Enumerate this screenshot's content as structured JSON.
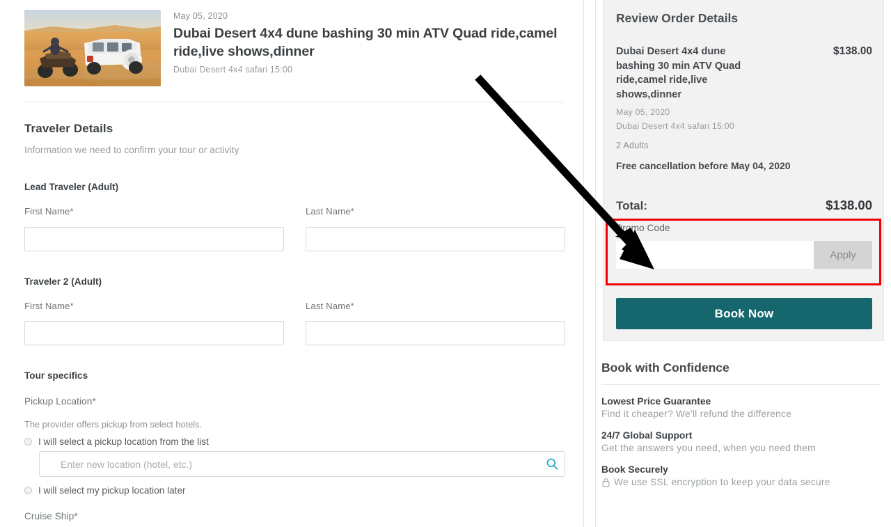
{
  "tour": {
    "date": "May 05, 2020",
    "title": "Dubai Desert 4x4 dune bashing 30 min ATV Quad ride,camel ride,live shows,dinner",
    "subtitle": "Dubai Desert 4x4 safari 15:00",
    "thumbnail_alt": "desert-safari-photo"
  },
  "traveler_section": {
    "heading": "Traveler Details",
    "subheading": "Information we need to confirm your tour or activity",
    "lead_group": "Lead Traveler (Adult)",
    "second_group": "Traveler 2 (Adult)",
    "first_name_label": "First Name*",
    "last_name_label": "Last Name*",
    "lead_first_value": "",
    "lead_last_value": "",
    "t2_first_value": "",
    "t2_last_value": ""
  },
  "tour_specifics": {
    "heading": "Tour specifics",
    "pickup_label": "Pickup Location*",
    "pickup_note": "The provider offers pickup from select hotels.",
    "radio_from_list": "I will select a pickup location from the list",
    "radio_later": "I will select my pickup location later",
    "location_placeholder": "Enter new location (hotel, etc.)",
    "location_value": "",
    "cruise_label": "Cruise Ship*"
  },
  "order": {
    "heading": "Review Order Details",
    "item_name": "Dubai Desert 4x4 dune bashing 30 min ATV Quad ride,camel ride,live shows,dinner",
    "item_price": "$138.00",
    "item_date": "May 05, 2020",
    "item_time": "Dubai Desert 4x4 safari 15:00",
    "item_pax": "2 Adults",
    "cancellation": "Free cancellation before May 04, 2020",
    "total_label": "Total:",
    "total_value": "$138.00",
    "promo_label": "Promo Code",
    "promo_value": "",
    "apply_label": "Apply",
    "book_label": "Book Now"
  },
  "confidence": {
    "heading": "Book with Confidence",
    "items": [
      {
        "title": "Lowest Price Guarantee",
        "desc": "Find it cheaper? We'll refund the difference"
      },
      {
        "title": "24/7 Global Support",
        "desc": "Get the answers you need, when you need them"
      },
      {
        "title": "Book Securely",
        "desc": "We use SSL encryption to keep your data secure"
      }
    ]
  },
  "colors": {
    "brand_teal": "#15666d",
    "annotation_red": "#f20000",
    "panel_gray": "#f2f2f2",
    "search_icon": "#2aa8c4"
  }
}
